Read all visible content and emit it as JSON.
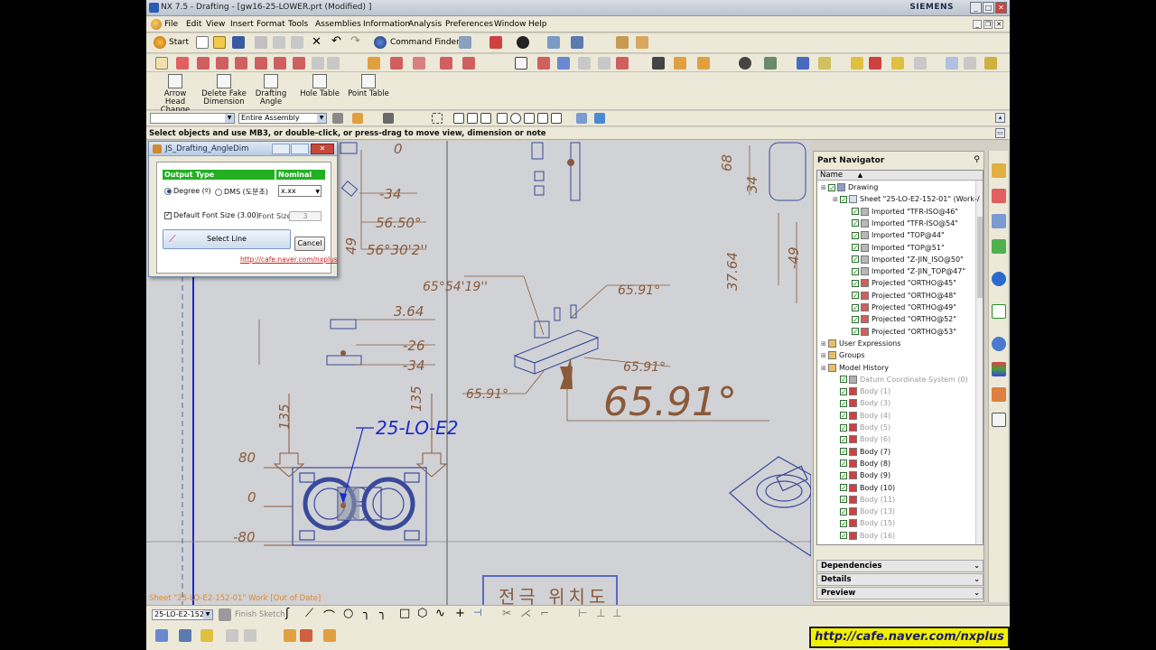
{
  "window": {
    "title": "NX 7.5 - Drafting - [gw16-25-LOWER.prt (Modified) ]",
    "brand": "SIEMENS"
  },
  "menu": [
    "File",
    "Edit",
    "View",
    "Insert",
    "Format",
    "Tools",
    "Assemblies",
    "Information",
    "Analysis",
    "Preferences",
    "Window",
    "Help"
  ],
  "toolbar": {
    "start_label": "Start",
    "command_finder_label": "Command Finder"
  },
  "big_tools": [
    {
      "label1": "Arrow Head",
      "label2": "Change"
    },
    {
      "label1": "Delete Fake",
      "label2": "Dimension"
    },
    {
      "label1": "Drafting",
      "label2": "Angle"
    },
    {
      "label1": "Hole Table",
      "label2": ""
    },
    {
      "label1": "Point Table",
      "label2": ""
    }
  ],
  "selection": {
    "filter_value": "",
    "scope_value": "Entire Assembly"
  },
  "cue_line": "Select objects and use MB3, or double-click, or press-drag to move view, dimension or note",
  "status_line": "Sheet \"25-LO-E2-152-01\" Work [Out of Date]",
  "dialog": {
    "title": "JS_Drafting_AngleDim",
    "output_type_header": "Output Type",
    "nominal_header": "Nominal",
    "degree_label": "Degree (º)",
    "dms_label": "DMS (도분초)",
    "nominal_value": "x.xx",
    "default_font_label": "Default Font Size (3.00)",
    "font_size_label": "Font Size",
    "font_size_value": "3",
    "select_line_label": "Select Line",
    "cancel_label": "Cancel",
    "link": "http://cafe.naver.com/nxplus"
  },
  "drawing": {
    "dims": [
      "-34",
      "56.50°",
      "56°30'2''",
      "3.64",
      "-26",
      "-34",
      "65°54'19''",
      "65.91°",
      "65.91°",
      "65.91°",
      "65.91°",
      "68",
      "34",
      "37.64",
      "-49",
      "49",
      "135",
      "135",
      "80",
      "0",
      "-80",
      "0"
    ],
    "view_label": "25-LO-E2",
    "korean_title": "전극 위치도"
  },
  "navigator": {
    "title": "Part Navigator",
    "column_header": "Name",
    "rows": [
      {
        "indent": 0,
        "text": "Drawing",
        "dim": false,
        "icon": "drawing"
      },
      {
        "indent": 1,
        "text": "Sheet \"25-LO-E2-152-01\" (Work-/",
        "dim": false,
        "icon": "sheet"
      },
      {
        "indent": 2,
        "text": "Imported \"TFR-ISO@46\"",
        "dim": false,
        "icon": "view"
      },
      {
        "indent": 2,
        "text": "Imported \"TFR-ISO@54\"",
        "dim": false,
        "icon": "view"
      },
      {
        "indent": 2,
        "text": "Imported \"TOP@44\"",
        "dim": false,
        "icon": "view"
      },
      {
        "indent": 2,
        "text": "Imported \"TOP@51\"",
        "dim": false,
        "icon": "view"
      },
      {
        "indent": 2,
        "text": "Imported \"Z-JIN_ISO@50\"",
        "dim": false,
        "icon": "view"
      },
      {
        "indent": 2,
        "text": "Imported \"Z-JIN_TOP@47\"",
        "dim": false,
        "icon": "view"
      },
      {
        "indent": 2,
        "text": "Projected \"ORTHO@45\"",
        "dim": false,
        "icon": "proj"
      },
      {
        "indent": 2,
        "text": "Projected \"ORTHO@48\"",
        "dim": false,
        "icon": "proj"
      },
      {
        "indent": 2,
        "text": "Projected \"ORTHO@49\"",
        "dim": false,
        "icon": "proj"
      },
      {
        "indent": 2,
        "text": "Projected \"ORTHO@52\"",
        "dim": false,
        "icon": "proj"
      },
      {
        "indent": 2,
        "text": "Projected \"ORTHO@53\"",
        "dim": false,
        "icon": "proj"
      },
      {
        "indent": 0,
        "text": "User Expressions",
        "dim": false,
        "icon": "folder"
      },
      {
        "indent": 0,
        "text": "Groups",
        "dim": false,
        "icon": "folder"
      },
      {
        "indent": 0,
        "text": "Model History",
        "dim": false,
        "icon": "folder"
      },
      {
        "indent": 1,
        "text": "Datum Coordinate System (0)",
        "dim": true,
        "icon": "datum"
      },
      {
        "indent": 1,
        "text": "Body (1)",
        "dim": true,
        "icon": "body"
      },
      {
        "indent": 1,
        "text": "Body (3)",
        "dim": true,
        "icon": "body"
      },
      {
        "indent": 1,
        "text": "Body (4)",
        "dim": true,
        "icon": "body"
      },
      {
        "indent": 1,
        "text": "Body (5)",
        "dim": true,
        "icon": "body"
      },
      {
        "indent": 1,
        "text": "Body (6)",
        "dim": true,
        "icon": "body"
      },
      {
        "indent": 1,
        "text": "Body (7)",
        "dim": false,
        "icon": "body"
      },
      {
        "indent": 1,
        "text": "Body (8)",
        "dim": false,
        "icon": "body"
      },
      {
        "indent": 1,
        "text": "Body (9)",
        "dim": false,
        "icon": "body"
      },
      {
        "indent": 1,
        "text": "Body (10)",
        "dim": false,
        "icon": "body"
      },
      {
        "indent": 1,
        "text": "Body (11)",
        "dim": true,
        "icon": "body"
      },
      {
        "indent": 1,
        "text": "Body (13)",
        "dim": true,
        "icon": "body"
      },
      {
        "indent": 1,
        "text": "Body (15)",
        "dim": true,
        "icon": "body"
      },
      {
        "indent": 1,
        "text": "Body (16)",
        "dim": true,
        "icon": "body"
      }
    ],
    "sections": [
      "Dependencies",
      "Details",
      "Preview"
    ]
  },
  "bottom": {
    "sheet_combo": "25-LO-E2-152",
    "finish_sketch": "Finish Sketch"
  },
  "banner": "http://cafe.naver.com/nxplus",
  "colors": {
    "dim_text": "#8a5a3a",
    "view_border": "#3a4a9a",
    "label_blue": "#1a2ac8",
    "check_green": "#1a8a1a"
  }
}
